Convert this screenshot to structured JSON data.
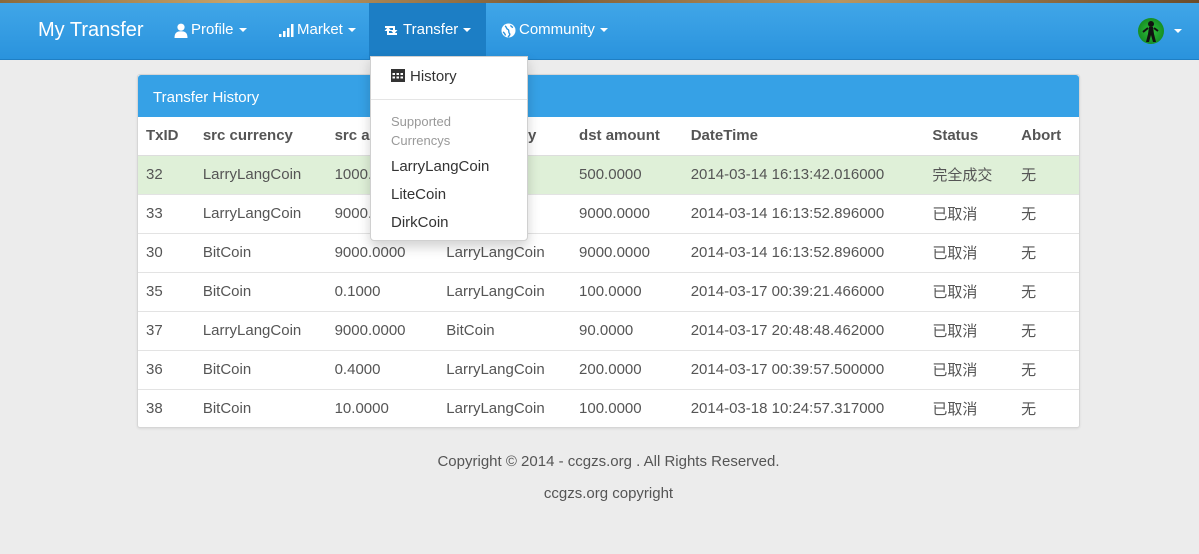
{
  "navbar": {
    "brand": "My Transfer",
    "items": [
      {
        "label": "Profile",
        "icon": "user-icon"
      },
      {
        "label": "Market",
        "icon": "signal-icon"
      },
      {
        "label": "Transfer",
        "icon": "retweet-icon"
      },
      {
        "label": "Community",
        "icon": "globe-icon"
      }
    ],
    "active_color": "#1c7ec5",
    "bar_color": "#2a93dd"
  },
  "dropdown": {
    "history_label": "History",
    "header": "Supported Currencys",
    "currencies": [
      "LarryLangCoin",
      "LiteCoin",
      "DirkCoin"
    ]
  },
  "panel": {
    "title": "Transfer History",
    "heading_color": "#36a1e6",
    "columns": [
      "TxID",
      "src currency",
      "src amount",
      "dst currency",
      "dst amount",
      "DateTime",
      "Status",
      "Abort"
    ],
    "rows": [
      [
        "32",
        "LarryLangCoin",
        "1000.0000",
        "",
        "500.0000",
        "2014-03-14 16:13:42.016000",
        "完全成交",
        "无"
      ],
      [
        "33",
        "LarryLangCoin",
        "9000.0000",
        "",
        "9000.0000",
        "2014-03-14 16:13:52.896000",
        "已取消",
        "无"
      ],
      [
        "30",
        "BitCoin",
        "9000.0000",
        "LarryLangCoin",
        "9000.0000",
        "2014-03-14 16:13:52.896000",
        "已取消",
        "无"
      ],
      [
        "35",
        "BitCoin",
        "0.1000",
        "LarryLangCoin",
        "100.0000",
        "2014-03-17 00:39:21.466000",
        "已取消",
        "无"
      ],
      [
        "37",
        "LarryLangCoin",
        "9000.0000",
        "BitCoin",
        "90.0000",
        "2014-03-17 20:48:48.462000",
        "已取消",
        "无"
      ],
      [
        "36",
        "BitCoin",
        "0.4000",
        "LarryLangCoin",
        "200.0000",
        "2014-03-17 00:39:57.500000",
        "已取消",
        "无"
      ],
      [
        "38",
        "BitCoin",
        "10.0000",
        "LarryLangCoin",
        "100.0000",
        "2014-03-18 10:24:57.317000",
        "已取消",
        "无"
      ]
    ],
    "success_row_color": "#dff0d8"
  },
  "footer": {
    "copyright": "Copyright © 2014 - ccgzs.org . All Rights Reserved.",
    "line2": "ccgzs.org copyright"
  }
}
